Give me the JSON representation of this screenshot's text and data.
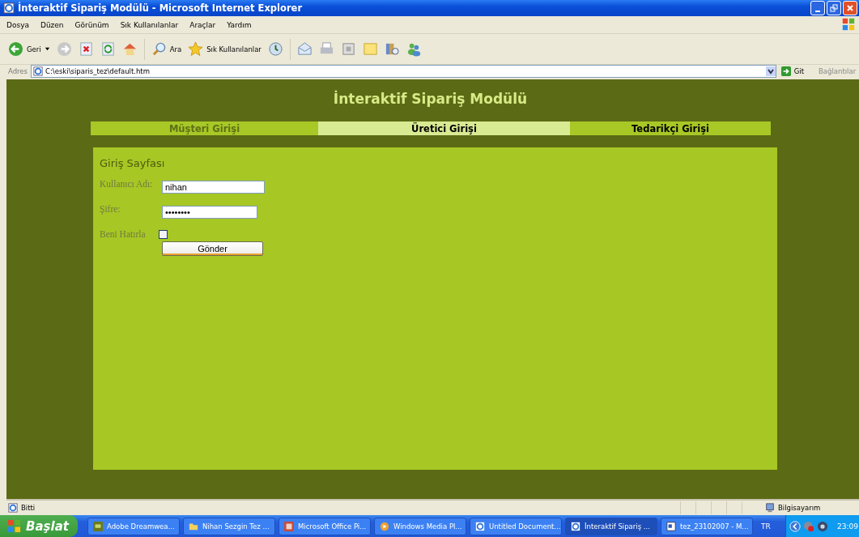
{
  "window": {
    "title": "İnteraktif Sipariş Modülü - Microsoft Internet Explorer"
  },
  "menu": [
    "Dosya",
    "Düzen",
    "Görünüm",
    "Sık Kullanılanlar",
    "Araçlar",
    "Yardım"
  ],
  "toolbar": {
    "back": "Geri",
    "search": "Ara",
    "favorites": "Sık Kullanılanlar"
  },
  "address_bar": {
    "label": "Adres",
    "value": "C:\\eski\\siparis_tez\\default.htm",
    "go": "Git",
    "links": "Bağlantılar"
  },
  "page": {
    "heading": "İnteraktif Sipariş Modülü",
    "tabs": [
      {
        "label": "Müşteri Girişi",
        "selected": false,
        "visited": true
      },
      {
        "label": "Üretici Girişi",
        "selected": true,
        "visited": false
      },
      {
        "label": "Tedarikçi Girişi",
        "selected": false,
        "visited": false
      }
    ],
    "form": {
      "title": "Giriş Sayfası",
      "fields": [
        {
          "label": "Kullanıcı Adı:",
          "value": "nihan"
        },
        {
          "label": "Şifre:",
          "value": "••••••••"
        }
      ],
      "remember": {
        "label": "Beni Hatırla",
        "checked": false
      },
      "submit": "Gönder"
    }
  },
  "status_bar": {
    "text": "Bitti",
    "zone": "Bilgisayarım"
  },
  "taskbar": {
    "start": "Başlat",
    "tasks": [
      {
        "label": "Adobe Dreamwea...",
        "kind": "dw",
        "selected": false
      },
      {
        "label": "Nihan Sezgin Tez ...",
        "kind": "folder",
        "selected": false
      },
      {
        "label": "Microsoft Office Pi...",
        "kind": "office",
        "selected": false
      },
      {
        "label": "Windows Media Pl...",
        "kind": "media",
        "selected": false
      },
      {
        "label": "Untitled Document...",
        "kind": "ie",
        "selected": false
      },
      {
        "label": "İnteraktif Sipariş ...",
        "kind": "ie",
        "selected": true
      },
      {
        "label": "tez_23102007 - M...",
        "kind": "word",
        "selected": false
      }
    ],
    "language": "TR",
    "clock": "23:09"
  }
}
